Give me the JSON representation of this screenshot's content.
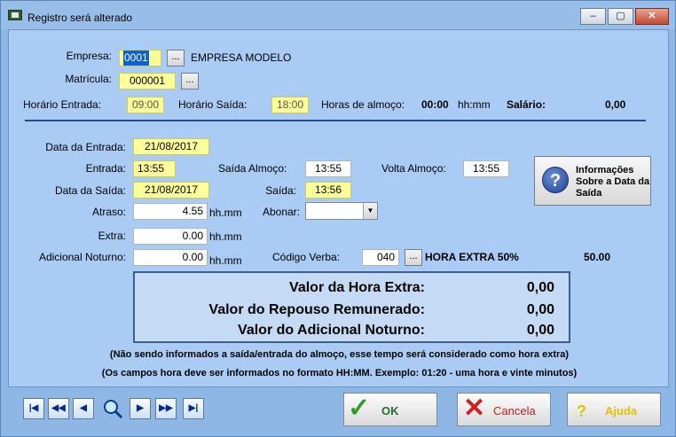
{
  "window": {
    "title": "Registro será alterado",
    "min": "–",
    "max": "▢",
    "close": "✕"
  },
  "form": {
    "empresa_label": "Empresa:",
    "empresa_value": "0001",
    "empresa_name": "EMPRESA MODELO",
    "matricula_label": "Matrícula:",
    "matricula_value": "000001",
    "horario_entrada_label": "Horário Entrada:",
    "horario_entrada_value": "09:00",
    "horario_saida_label": "Horário Saída:",
    "horario_saida_value": "18:00",
    "horas_almoco_label": "Horas de almoço:",
    "horas_almoco_value": "00:00",
    "horas_almoco_unit": "hh:mm",
    "salario_label": "Salário:",
    "salario_value": "0,00",
    "dots": "...",
    "data_entrada_label": "Data da Entrada:",
    "data_entrada_value": "21/08/2017",
    "entrada_label": "Entrada:",
    "entrada_value": "13:55",
    "saida_almoco_label": "Saída Almoço:",
    "saida_almoco_value": "13:55",
    "volta_almoco_label": "Volta Almoço:",
    "volta_almoco_value": "13:55",
    "data_saida_label": "Data da Saída:",
    "data_saida_value": "21/08/2017",
    "saida_label": "Saída:",
    "saida_value": "13:56",
    "atraso_label": "Atraso:",
    "atraso_value": "4.55",
    "unit": "hh.mm",
    "abonar_label": "Abonar:",
    "abonar_value": "",
    "extra_label": "Extra:",
    "extra_value": "0.00",
    "adicional_label": "Adicional Noturno:",
    "adicional_value": "0.00",
    "codigo_verba_label": "Código Verba:",
    "codigo_verba_value": "040",
    "verba_desc": "HORA EXTRA 50%",
    "verba_pct": "50.00",
    "info_button": "Informações Sobre a Data da Saída"
  },
  "summary": {
    "hora_extra_label": "Valor da Hora Extra:",
    "hora_extra_value": "0,00",
    "repouso_label": "Valor do Repouso Remunerado:",
    "repouso_value": "0,00",
    "adicional_label": "Valor do Adicional Noturno:",
    "adicional_value": "0,00"
  },
  "notes": [
    "(Não sendo informados a saída/entrada do almoço, esse tempo será considerado como hora extra)",
    "(Os campos hora deve ser informados no formato HH:MM. Exemplo: 01:20 - uma hora e vinte minutos)"
  ],
  "navigation": {
    "first": "|◀",
    "prev_page": "◀◀",
    "prev": "◀",
    "search_icon": "search-icon",
    "next": "▶",
    "next_page": "▶▶",
    "last": "▶|"
  },
  "buttons": {
    "ok": "OK",
    "ok_icon": "✓",
    "cancel": "Cancela",
    "cancel_icon": "✕",
    "help": "Ajuda",
    "help_icon": "?"
  },
  "colors": {
    "field_highlight": "#ffff99",
    "client_bg": "#a9cbf4",
    "divider": "#1f4e8a",
    "ok_icon": "#2f9a2f",
    "cancel_icon": "#d02020",
    "help_text": "#e0c200"
  }
}
